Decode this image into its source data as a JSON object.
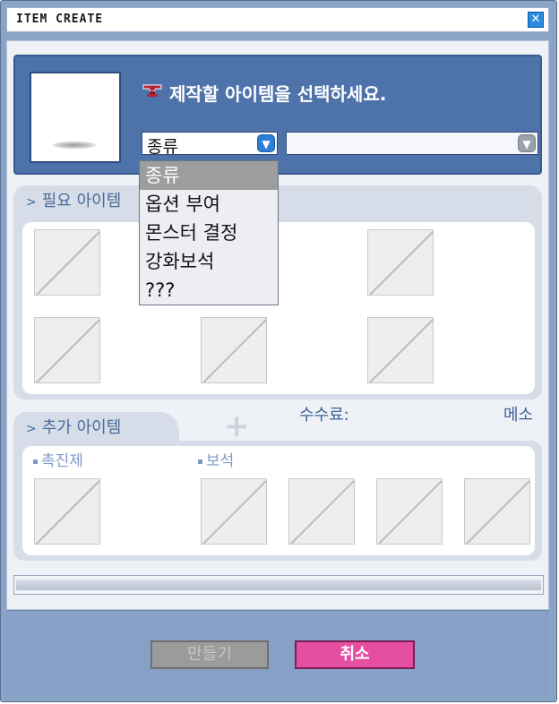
{
  "window": {
    "title": "ITEM CREATE",
    "close_icon": "close-icon"
  },
  "header": {
    "prompt": "제작할 아이템을 선택하세요.",
    "prompt_icon": "anvil-icon",
    "category_select": {
      "value": "종류"
    },
    "item_select": {
      "value": ""
    }
  },
  "category_dropdown": {
    "options": [
      "종류",
      "옵션 부여",
      "몬스터 결정",
      "강화보석",
      "???"
    ],
    "selected_index": 0
  },
  "required_items": {
    "label": "필요 아이템",
    "chevron_icon": "chevron-right-icon",
    "slot_count": 6
  },
  "fee": {
    "label": "수수료:",
    "unit": "메소"
  },
  "additional_items": {
    "label": "추가 아이템",
    "plus_icon": "plus-icon",
    "catalyst_label": "촉진제",
    "gem_label": "보석",
    "catalyst_slots": 1,
    "gem_slots": 4
  },
  "progress": {
    "fraction": 0
  },
  "buttons": {
    "make": "만들기",
    "cancel": "취소"
  },
  "colors": {
    "header_blue": "#4e73ab",
    "cancel_pink": "#e64fa1",
    "disabled_gray": "#9b9b9b",
    "dropdown_selected": "#9d9d9d"
  }
}
